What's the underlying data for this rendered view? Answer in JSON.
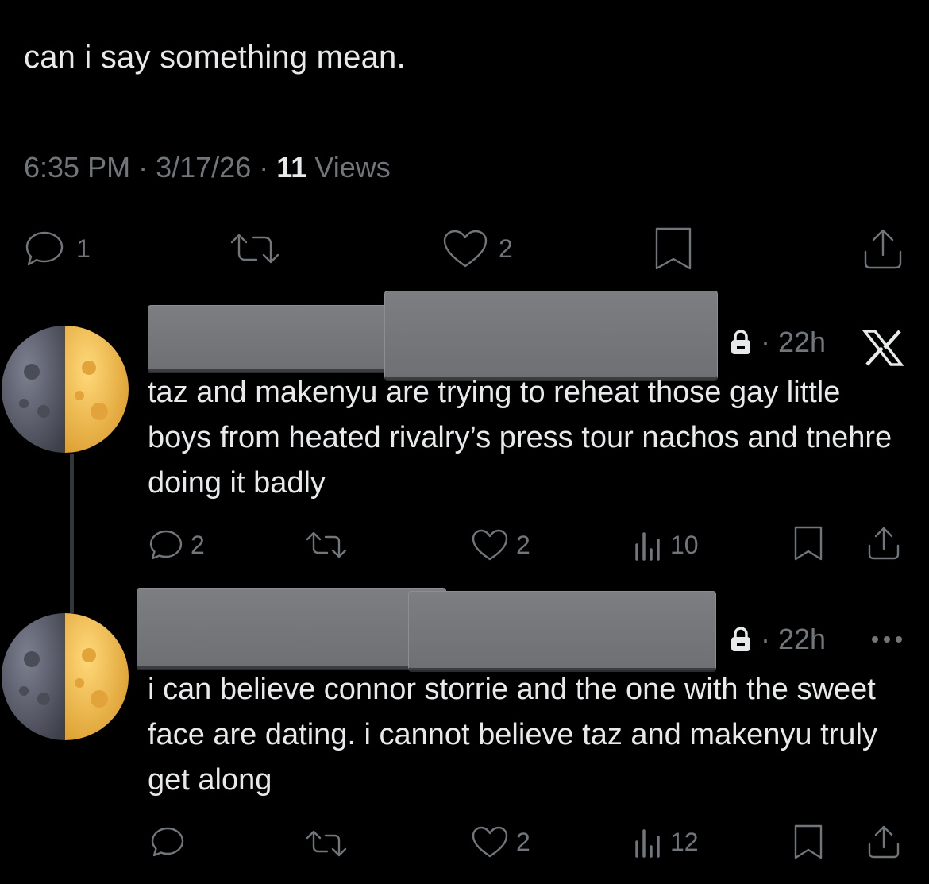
{
  "post": {
    "text": "can i say something mean.",
    "time": "6:35 PM",
    "date": "3/17/26",
    "views_count": "11",
    "views_label": "Views",
    "separator": "·",
    "actions": {
      "reply_count": "1",
      "retweet_count": "",
      "like_count": "2"
    }
  },
  "replies": [
    {
      "time": "22h",
      "separator": "·",
      "text": "taz and makenyu are trying to reheat those gay little boys from heated rivalry’s press tour nachos and tnehre doing it badly",
      "reply_count": "2",
      "like_count": "2",
      "views_count": "10",
      "menu_icon": "x-logo-icon"
    },
    {
      "time": "22h",
      "separator": "·",
      "text": "i can believe connor storrie and the one with the sweet face are dating. i cannot believe taz and makenyu truly get along",
      "reply_count": "",
      "like_count": "2",
      "views_count": "12",
      "menu_icon": "more-icon"
    }
  ],
  "colors": {
    "background": "#000000",
    "text": "#e7e9ea",
    "secondary": "#71767b",
    "moon_gold": "#f0b84c",
    "moon_gray": "#5e6170"
  }
}
